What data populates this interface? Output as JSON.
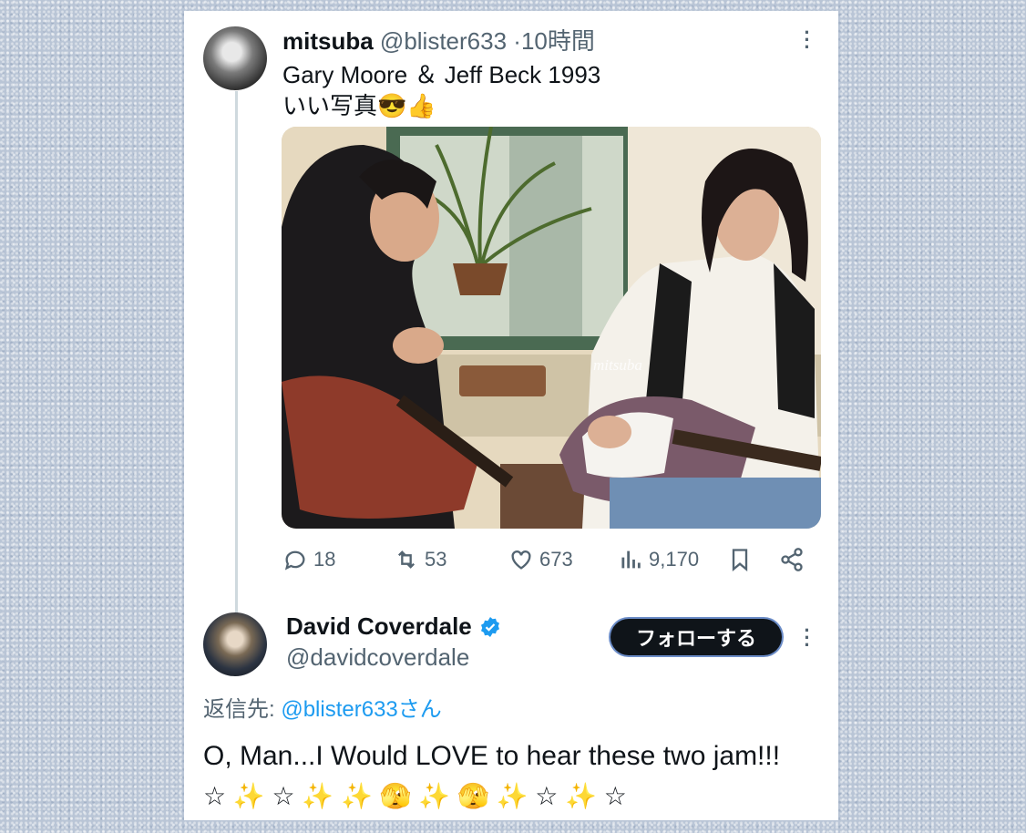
{
  "original_tweet": {
    "author_name": "mitsuba",
    "author_handle": "@blister633",
    "separator": "·",
    "time": "10時間",
    "line1": "Gary Moore ＆ Jeff Beck  1993",
    "line2": "いい写真😎👍",
    "image_watermark": "mitsuba",
    "stats": {
      "replies": "18",
      "retweets": "53",
      "likes": "673",
      "views": "9,170"
    }
  },
  "reply_tweet": {
    "author_name": "David Coverdale",
    "author_handle": "@davidcoverdale",
    "verified": true,
    "follow_label": "フォローする",
    "reply_prefix": "返信先: ",
    "reply_to": "@blister633さん",
    "text": "O, Man...I Would LOVE to hear these two jam!!! ",
    "emojis": "☆ ✨ ☆ ✨ ✨ 🫣 ✨ 🫣 ✨ ☆ ✨ ☆"
  },
  "icons": {
    "more": "more-dots-icon",
    "reply": "reply-icon",
    "retweet": "retweet-icon",
    "like": "heart-icon",
    "views": "views-icon",
    "bookmark": "bookmark-icon",
    "share": "share-icon",
    "verified": "verified-badge-icon"
  },
  "colors": {
    "text": "#0f1419",
    "muted": "#536471",
    "link": "#1d9bf0",
    "verified": "#1d9bf0"
  }
}
